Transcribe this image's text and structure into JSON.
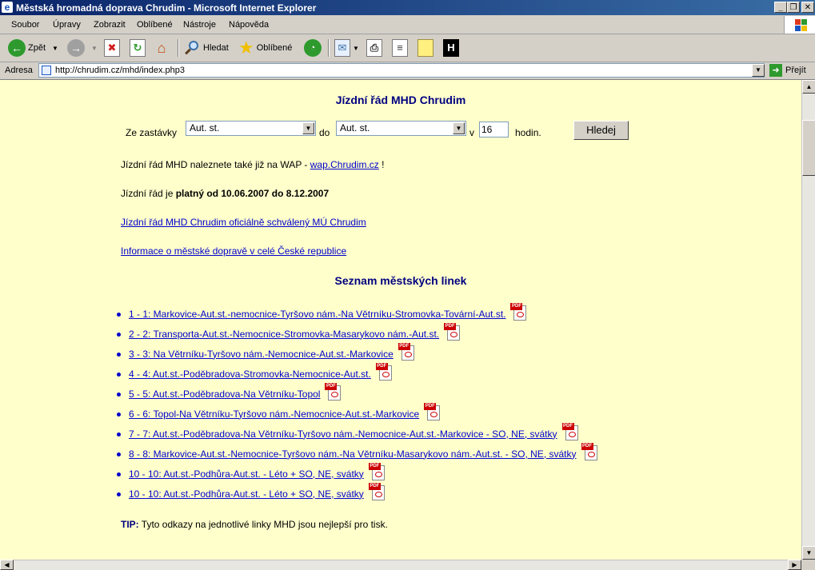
{
  "window": {
    "title": "Městská hromadná doprava Chrudim - Microsoft Internet Explorer",
    "controls": {
      "minimize": "_",
      "maximize": "❐",
      "close": "✕"
    }
  },
  "menu": [
    "Soubor",
    "Úpravy",
    "Zobrazit",
    "Oblíbené",
    "Nástroje",
    "Nápověda"
  ],
  "toolbar": {
    "back_label": "Zpět",
    "search_label": "Hledat",
    "favorites_label": "Oblíbené"
  },
  "address": {
    "label": "Adresa",
    "url": "http://chrudim.cz/mhd/index.php3",
    "go_label": "Přejít"
  },
  "page": {
    "title": "Jízdní řád MHD Chrudim",
    "form": {
      "from_label": "Ze zastávky",
      "from_value": "Aut. st.",
      "to_label": "do",
      "to_value": "Aut. st.",
      "at_label": "v",
      "hours_value": "16",
      "hours_label": "hodin.",
      "search_button": "Hledej"
    },
    "wap_text": "Jízdní řád MHD naleznete také již na WAP - ",
    "wap_link": "wap.Chrudim.cz",
    "wap_suffix": " !",
    "valid_prefix": "Jízdní řád je ",
    "valid_bold": "platný od 10.06.2007 do 8.12.2007",
    "official_link": "Jízdní řád MHD Chrudim oficiálně schválený MÚ Chrudim",
    "info_link": "Informace o městské dopravě v celé České republice",
    "routes_title": "Seznam městských linek",
    "routes": [
      "1 - 1: Markovice-Aut.st.-nemocnice-Tyršovo nám.-Na Větrníku-Stromovka-Tovární-Aut.st.",
      "2 - 2: Transporta-Aut.st.-Nemocnice-Stromovka-Masarykovo nám.-Aut.st.",
      "3 - 3: Na Větrníku-Tyršovo nám.-Nemocnice-Aut.st.-Markovice",
      "4 - 4: Aut.st.-Poděbradova-Stromovka-Nemocnice-Aut.st.",
      "5 - 5: Aut.st.-Poděbradova-Na Větrníku-Topol",
      "6 - 6: Topol-Na Větrníku-Tyršovo nám.-Nemocnice-Aut.st.-Markovice",
      "7 - 7: Aut.st.-Poděbradova-Na Větrníku-Tyršovo nám.-Nemocnice-Aut.st.-Markovice - SO, NE, svátky",
      "8 - 8: Markovice-Aut.st.-Nemocnice-Tyršovo nám.-Na Větrníku-Masarykovo nám.-Aut.st. - SO, NE, svátky",
      "10 - 10: Aut.st.-Podhůra-Aut.st. - Léto + SO, NE, svátky",
      "10 - 10: Aut.st.-Podhůra-Aut.st. - Léto + SO, NE, svátky"
    ],
    "pdf_tag": "PDF",
    "tip_label": "TIP:",
    "tip_text": " Tyto odkazy na jednotlivé linky MHD jsou nejlepší pro tisk."
  }
}
